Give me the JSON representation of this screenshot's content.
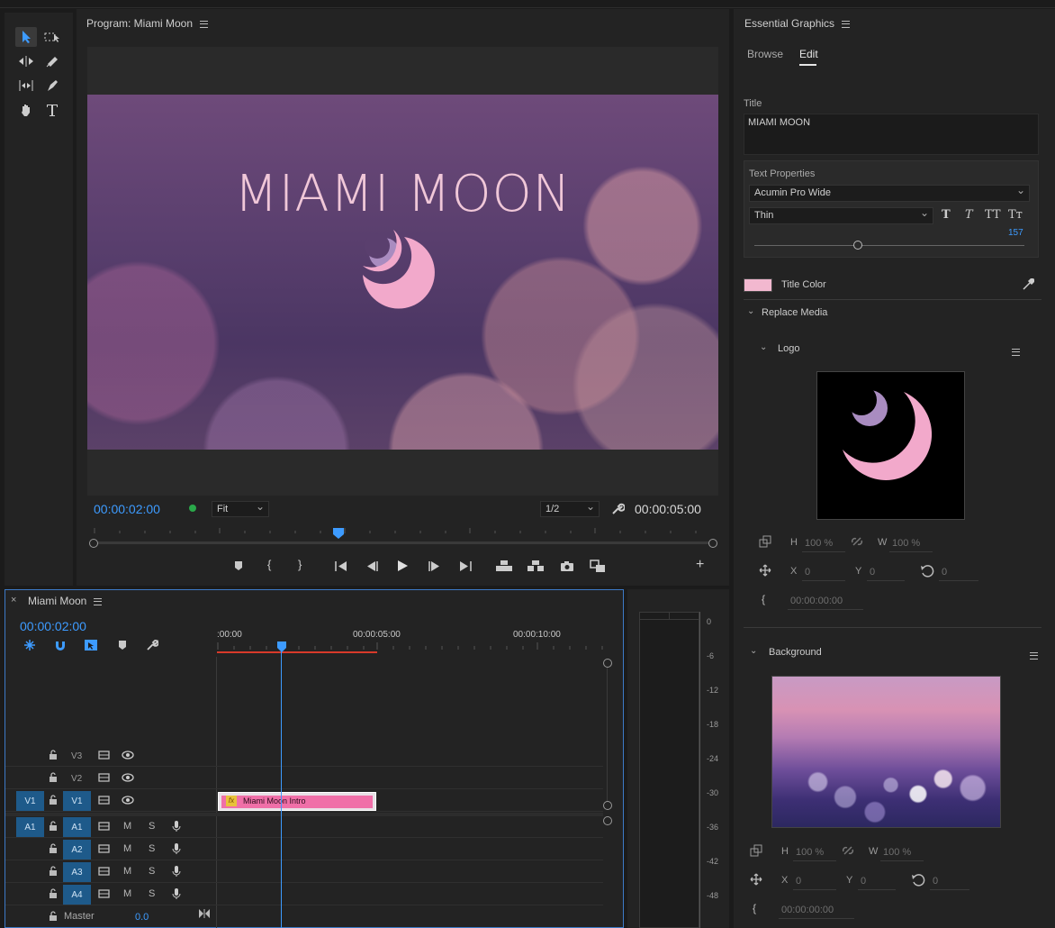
{
  "program": {
    "title": "Program: Miami Moon",
    "frame_title": "MIAMI MOON",
    "timecode_current": "00:00:02:00",
    "zoom": "Fit",
    "resolution": "1/2",
    "timecode_duration": "00:00:05:00"
  },
  "timeline": {
    "sequence_name": "Miami Moon",
    "timecode": "00:00:02:00",
    "ruler": [
      ":00:00",
      "00:00:05:00",
      "00:00:10:00"
    ],
    "video_tracks": [
      {
        "name": "V3",
        "source": ""
      },
      {
        "name": "V2",
        "source": ""
      },
      {
        "name": "V1",
        "source": "V1"
      }
    ],
    "audio_tracks": [
      {
        "name": "A1",
        "source": "A1",
        "m": "M",
        "s": "S"
      },
      {
        "name": "A2",
        "source": "",
        "m": "M",
        "s": "S"
      },
      {
        "name": "A3",
        "source": "",
        "m": "M",
        "s": "S"
      },
      {
        "name": "A4",
        "source": "",
        "m": "M",
        "s": "S"
      }
    ],
    "master_label": "Master",
    "master_value": "0.0",
    "clip_name": "Miami Moon Intro",
    "clip_fx": "fx"
  },
  "meter": {
    "scale": [
      "0",
      "-6",
      "-12",
      "-18",
      "-24",
      "-30",
      "-36",
      "-42",
      "-48"
    ]
  },
  "essential_graphics": {
    "title": "Essential Graphics",
    "tabs": [
      "Browse",
      "Edit"
    ],
    "active_tab": "Edit",
    "title_label": "Title",
    "title_value": "MIAMI MOON",
    "text_properties_label": "Text Properties",
    "font": "Acumin Pro Wide",
    "weight": "Thin",
    "font_size": "157",
    "style_buttons": [
      "T",
      "T",
      "TT",
      "Tт"
    ],
    "title_color_label": "Title Color",
    "title_color": "#f2b8cf",
    "replace_media_label": "Replace Media",
    "logo": {
      "label": "Logo",
      "h_label": "H",
      "h_value": "100 %",
      "w_label": "W",
      "w_value": "100 %",
      "x_label": "X",
      "x_value": "0",
      "y_label": "Y",
      "y_value": "0",
      "rotation_value": "0",
      "time": "00:00:00:00"
    },
    "background": {
      "label": "Background",
      "h_label": "H",
      "h_value": "100 %",
      "w_label": "W",
      "w_value": "100 %",
      "x_label": "X",
      "x_value": "0",
      "y_label": "Y",
      "y_value": "0",
      "rotation_value": "0",
      "time": "00:00:00:00"
    }
  },
  "colors": {
    "accent": "#3d9bff",
    "clip": "#f06fa8",
    "track_target": "#1e5a8a",
    "moon_pink": "#f2a9cb",
    "moon_lilac": "#a98cc0"
  }
}
